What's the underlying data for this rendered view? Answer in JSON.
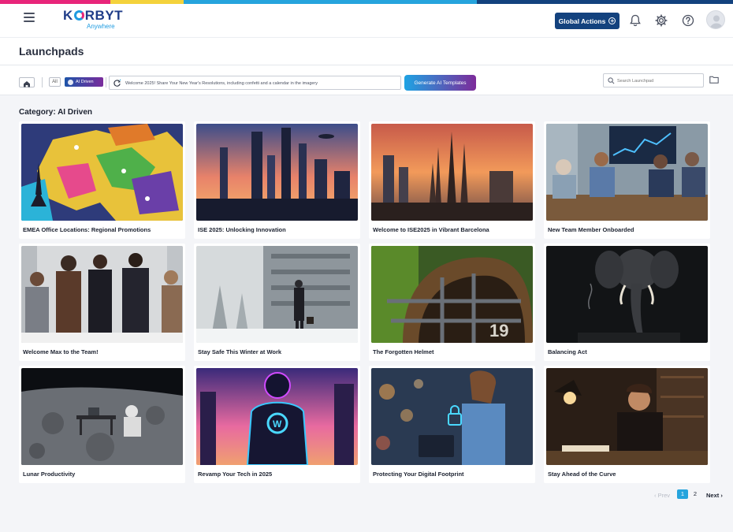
{
  "brand": {
    "logo_word": "KORBYT",
    "logo_sub": "Anywhere",
    "top_stripe_colors": [
      "#e8257a",
      "#f4d23c",
      "#26a4dd",
      "#13427e"
    ]
  },
  "header": {
    "menu_icon": "hamburger-icon",
    "global_actions_label": "Global Actions",
    "icons": [
      "bell-icon",
      "gear-icon",
      "help-icon",
      "user-avatar-icon"
    ]
  },
  "page": {
    "title": "Launchpads"
  },
  "toolbar": {
    "home_icon": "home-icon",
    "filter_all": "All",
    "filter_ai": "AI Driven",
    "prompt_value": "Welcome 2025! Share Your New Year's Resolutions, including confetti and a calendar in the imagery",
    "generate_label": "Generate AI Templates",
    "search_placeholder": "Search Launchpad",
    "folder_icon": "folder-icon"
  },
  "category": {
    "label": "Category: AI Driven"
  },
  "cards": [
    {
      "title": "EMEA Office Locations: Regional Promotions"
    },
    {
      "title": "ISE 2025: Unlocking Innovation"
    },
    {
      "title": "Welcome to ISE2025 in Vibrant Barcelona"
    },
    {
      "title": "New Team Member Onboarded"
    },
    {
      "title": "Welcome Max to the Team!"
    },
    {
      "title": "Stay Safe This Winter at Work"
    },
    {
      "title": "The Forgotten Helmet"
    },
    {
      "title": "Balancing Act"
    },
    {
      "title": "Lunar Productivity"
    },
    {
      "title": "Revamp Your Tech in 2025"
    },
    {
      "title": "Protecting Your Digital Footprint"
    },
    {
      "title": "Stay Ahead of the Curve"
    }
  ],
  "pagination": {
    "prev": "‹ Prev",
    "pages": [
      "1",
      "2"
    ],
    "current": "1",
    "next": "Next ›"
  }
}
